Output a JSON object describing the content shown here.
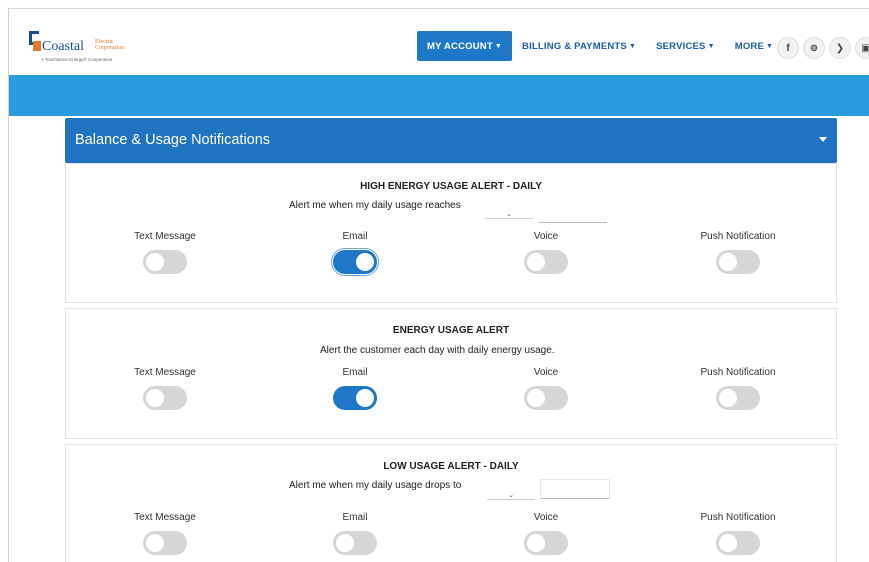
{
  "header": {
    "logo": {
      "word": "Coastal",
      "word2": "Electric Corporation",
      "tagline": "A Touchstone Energy® Cooperative"
    },
    "nav": [
      {
        "label": "MY ACCOUNT",
        "active": true
      },
      {
        "label": "BILLING & PAYMENTS",
        "active": false
      },
      {
        "label": "SERVICES",
        "active": false
      },
      {
        "label": "MORE",
        "active": false
      }
    ],
    "social": [
      {
        "glyph": "f",
        "icon": "facebook-icon"
      },
      {
        "glyph": "⊚",
        "icon": "pinterest-icon"
      },
      {
        "glyph": "❯",
        "icon": "twitter-icon"
      },
      {
        "glyph": "▣",
        "icon": "youtube-icon"
      }
    ]
  },
  "section": {
    "title": "Balance & Usage Notifications"
  },
  "channels": [
    "Text Message",
    "Email",
    "Voice",
    "Push Notification"
  ],
  "cards": [
    {
      "title": "HIGH ENERGY USAGE ALERT - DAILY",
      "description": "Alert me when my daily usage reaches",
      "select_value": "",
      "input_value": "",
      "toggles": [
        false,
        true,
        false,
        false
      ]
    },
    {
      "title": "ENERGY USAGE ALERT",
      "description": "Alert the customer each day with daily energy usage.",
      "toggles": [
        false,
        true,
        false,
        false
      ]
    },
    {
      "title": "LOW USAGE ALERT - DAILY",
      "description": "Alert me when my daily usage drops to",
      "select_value": "",
      "input_value": "",
      "toggles": [
        false,
        false,
        false,
        false
      ]
    }
  ],
  "colors": {
    "band": "#2b9be0",
    "section_header": "#1f73bf",
    "toggle_on": "#1f77c8",
    "toggle_off": "#d6d6d6"
  }
}
